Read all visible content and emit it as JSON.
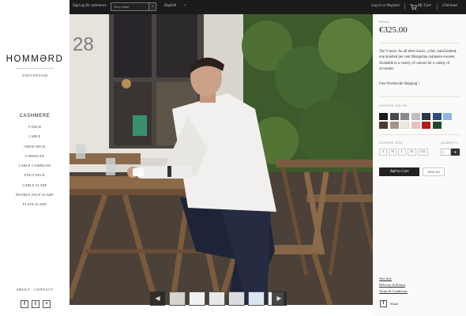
{
  "brand": {
    "logo": "HOMMƏRD",
    "city": "AMSTERDAM"
  },
  "sidebar": {
    "category": "CASHMERE",
    "items": [
      {
        "label": "V-NECK"
      },
      {
        "label": "CABLE"
      },
      {
        "label": "CREW-NECK"
      },
      {
        "label": "CARDIGAN"
      },
      {
        "label": "CABLE CARDIGAN"
      },
      {
        "label": "POLO NECK"
      },
      {
        "label": "CABLE SCARF"
      },
      {
        "label": "DOUBLE FACE SCARF"
      },
      {
        "label": "PLAIN SCARF"
      }
    ],
    "about": "ABOUT · CONTACT",
    "social": {
      "facebook": "f",
      "twitter": "t",
      "googleplus": "+"
    }
  },
  "topbar": {
    "signup_text": "Sign up for stylenews",
    "email_placeholder": "Your email",
    "email_submit": "›",
    "language": "English",
    "language_caret": "⌄",
    "login": "Log in or Register",
    "cart": "My Cart",
    "checkout": "Checkout"
  },
  "product": {
    "price_label": "PRICE",
    "price": "€325.00",
    "description": "The V-neck. An all time classic, a fine, hand knitted, one hundred per cent Mongolian cashmere sweater. Available in a variety of colours for a variety of occasions.",
    "shipping": "Free Worldwide Shipping !",
    "colour_label": "CHOOSE COLOR",
    "colours": [
      "#1a1a1a",
      "#4a4a4a",
      "#8a8a8a",
      "#bdbdbd",
      "#2b3346",
      "#2e4a7a",
      "#8fb4e3",
      "#4b3a2f",
      "#a69382",
      "#efe8df",
      "#eebfbf",
      "#b31b1b",
      "#1f4a2a"
    ],
    "size_label": "CHOOSE SIZE",
    "sizes": [
      {
        "label": "S"
      },
      {
        "label": "M"
      },
      {
        "label": "L"
      },
      {
        "label": "XL"
      },
      {
        "label": "XXL"
      }
    ],
    "qty_label": "QUANTITY",
    "qty_value": "1",
    "add_to_cart": "Add to Cart",
    "wish_list": "Wish list",
    "links": {
      "size_info": "Size Info",
      "delivery": "Delivery & Return",
      "terms": "Terms & Conditions"
    },
    "share_icon": "f",
    "share": "Share"
  },
  "hero": {
    "image": "man-in-white-shirt-cafe-photo",
    "door_number": "28"
  },
  "gallery": {
    "prev_icon": "◀",
    "next_icon": "▶",
    "thumbs": [
      {
        "tone": "#d7d2cb"
      },
      {
        "tone": "#f1f1f1"
      },
      {
        "tone": "#e8e8e8"
      },
      {
        "tone": "#dcdcdc"
      },
      {
        "tone": "#dbe6f2"
      },
      {
        "tone": "#f4f4f4"
      }
    ]
  }
}
